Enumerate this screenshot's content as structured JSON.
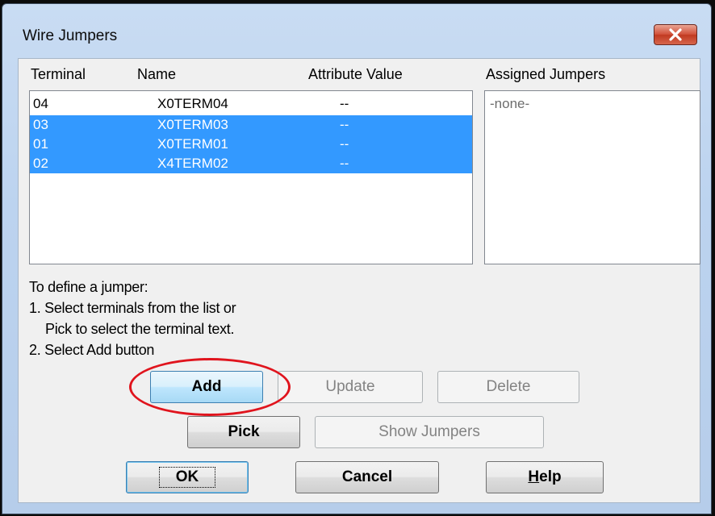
{
  "dialog": {
    "title": "Wire Jumpers",
    "columns": {
      "terminal": "Terminal",
      "name": "Name",
      "attribute_value": "Attribute Value",
      "assigned_jumpers": "Assigned Jumpers"
    },
    "rows": [
      {
        "terminal": "04",
        "name": "X0TERM04",
        "attr": "--",
        "selected": false
      },
      {
        "terminal": "03",
        "name": "X0TERM03",
        "attr": "--",
        "selected": true
      },
      {
        "terminal": "01",
        "name": "X0TERM01",
        "attr": "--",
        "selected": true
      },
      {
        "terminal": "02",
        "name": "X4TERM02",
        "attr": "--",
        "selected": true
      }
    ],
    "assigned_items": [
      "-none-"
    ],
    "instructions": {
      "line1": "To define a jumper:",
      "line2": "1. Select terminals from the list or",
      "line3": "Pick to select the terminal text.",
      "line4": "2. Select Add button"
    },
    "buttons": {
      "add": "Add",
      "update": "Update",
      "delete": "Delete",
      "pick": "Pick",
      "show_jumpers": "Show Jumpers",
      "ok": "OK",
      "cancel": "Cancel",
      "help_mnemonic": "H",
      "help_rest": "elp"
    }
  },
  "colors": {
    "selection": "#3399ff",
    "annotation": "#e0141d",
    "close_button": "#c13a21"
  },
  "icons": {
    "close": "close-icon"
  }
}
